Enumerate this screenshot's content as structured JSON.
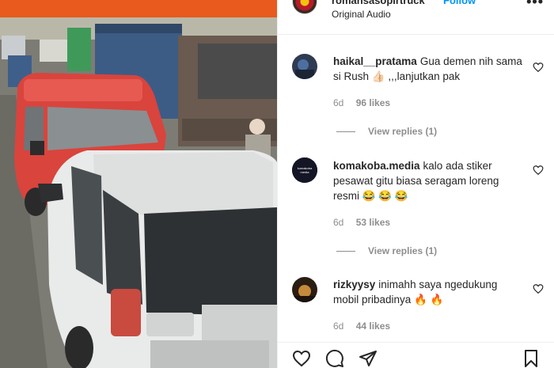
{
  "post": {
    "username": "romansasopirtruck",
    "follow_label": "Follow",
    "audio": "Original Audio",
    "more": "•••"
  },
  "comments": [
    {
      "username": "haikal__pratama",
      "text": "Gua demen nih sama si Rush 👍🏻 ,,,lanjutkan pak",
      "time": "6d",
      "likes": "96 likes",
      "replies": "View replies (1)"
    },
    {
      "username": "komakoba.media",
      "text": "kalo ada stiker pesawat gitu biasa seragam loreng resmi 😂 😂 😂",
      "time": "6d",
      "likes": "53 likes",
      "replies": "View replies (1)",
      "avatar_text": "komakoba media"
    },
    {
      "username": "rizkyysy",
      "text": "inimahh saya ngedukung mobil pribadinya 🔥 🔥",
      "time": "6d",
      "likes": "44 likes"
    }
  ],
  "icons": {
    "like": "heart-icon",
    "comment": "comment-icon",
    "share": "share-icon",
    "save": "bookmark-icon"
  },
  "colors": {
    "accent": "#0095f6",
    "muted": "#8e8e8e",
    "text": "#262626"
  }
}
